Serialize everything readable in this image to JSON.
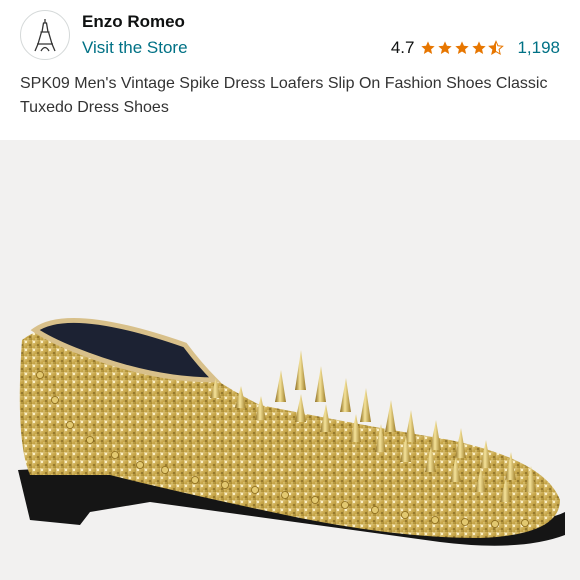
{
  "header": {
    "brand_name": "Enzo Romeo",
    "store_link": "Visit the Store",
    "logo_icon": "eiffel-tower-icon"
  },
  "rating": {
    "value": "4.7",
    "stars": 4.5,
    "count": "1,198",
    "star_color": "#e77600"
  },
  "product": {
    "title": "SPK09 Men's Vintage Spike Dress Loafers Slip On Fashion Shoes Classic Tuxedo Dress Shoes",
    "image": "gold-glitter-spike-loafer"
  },
  "colors": {
    "link": "#007185",
    "gold": "#d4b860",
    "sole": "#111111"
  }
}
